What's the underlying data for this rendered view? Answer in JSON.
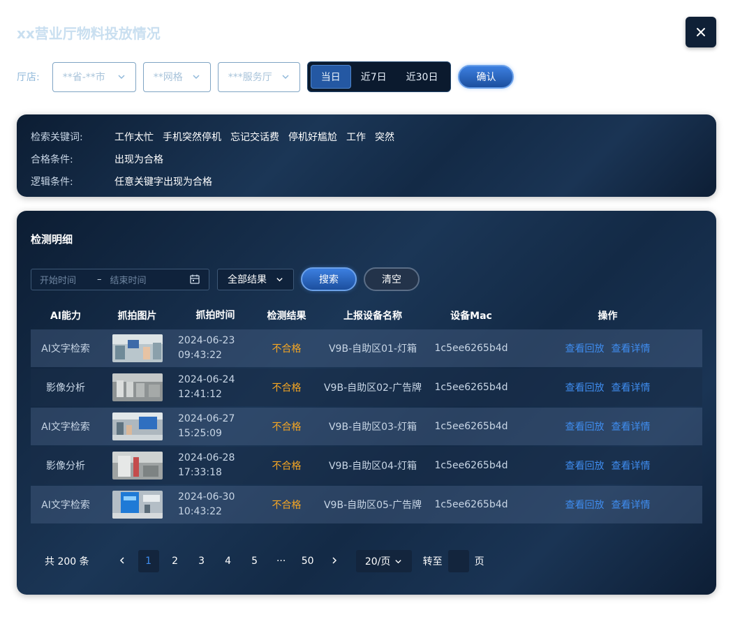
{
  "page": {
    "title": "xx营业厅物料投放情况"
  },
  "filters": {
    "label": "厅店:",
    "province": "**省-**市",
    "grid": "**网格",
    "hall": "***服务厅",
    "ranges": [
      "当日",
      "近7日",
      "近30日"
    ],
    "active_range": "当日",
    "confirm": "确认"
  },
  "keywords": {
    "search_label": "检索关键词:",
    "search_terms": [
      "工作太忙",
      "手机突然停机",
      "忘记交话费",
      "停机好尴尬",
      "工作",
      "突然"
    ],
    "qualify_label": "合格条件:",
    "qualify_value": "出现为合格",
    "logic_label": "逻辑条件:",
    "logic_value": "任意关键字出现为合格"
  },
  "detail": {
    "title": "检测明细",
    "start_placeholder": "开始时间",
    "range_sep": "–",
    "end_placeholder": "结束时间",
    "result_select": "全部结果",
    "search_btn": "搜索",
    "clear_btn": "清空",
    "columns": [
      "AI能力",
      "抓拍图片",
      "抓拍时间",
      "检测结果",
      "上报设备名称",
      "设备Mac",
      "操作"
    ],
    "rows": [
      {
        "ability": "AI文字检索",
        "date": "2024-06-23",
        "time": "09:43:22",
        "result": "不合格",
        "device": "V9B-自助区01-灯箱",
        "mac": "1c5ee6265b4d",
        "op1": "查看回放",
        "op2": "查看详情"
      },
      {
        "ability": "影像分析",
        "date": "2024-06-24",
        "time": "12:41:12",
        "result": "不合格",
        "device": "V9B-自助区02-广告牌",
        "mac": "1c5ee6265b4d",
        "op1": "查看回放",
        "op2": "查看详情"
      },
      {
        "ability": "AI文字检索",
        "date": "2024-06-27",
        "time": "15:25:09",
        "result": "不合格",
        "device": "V9B-自助区03-灯箱",
        "mac": "1c5ee6265b4d",
        "op1": "查看回放",
        "op2": "查看详情"
      },
      {
        "ability": "影像分析",
        "date": "2024-06-28",
        "time": "17:33:18",
        "result": "不合格",
        "device": "V9B-自助区04-灯箱",
        "mac": "1c5ee6265b4d",
        "op1": "查看回放",
        "op2": "查看详情"
      },
      {
        "ability": "AI文字检索",
        "date": "2024-06-30",
        "time": "10:43:22",
        "result": "不合格",
        "device": "V9B-自助区05-广告牌",
        "mac": "1c5ee6265b4d",
        "op1": "查看回放",
        "op2": "查看详情"
      }
    ]
  },
  "pagination": {
    "total": "共 200 条",
    "pages": [
      "1",
      "2",
      "3",
      "4",
      "5",
      "···",
      "50"
    ],
    "current": "1",
    "page_size": "20/页",
    "goto_label": "转至",
    "page_unit": "页"
  },
  "colors": {
    "accent": "#3f8df0",
    "fail": "#f5a623",
    "panel": "#132a46"
  }
}
